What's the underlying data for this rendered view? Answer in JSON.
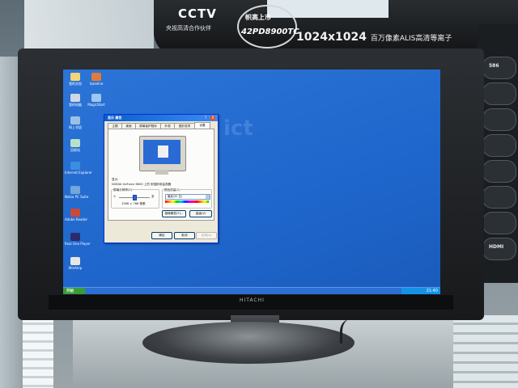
{
  "banner": {
    "logo": "CCTV",
    "logo_sub": "央视高清合作伙伴",
    "badge_cn": "帜高上市",
    "badge_model": "42PD8900TC",
    "resolution": "1024x1024",
    "resolution_sub": "百万像素ALIS高清等离子"
  },
  "promo": {
    "items": [
      "586",
      "",
      "",
      "",
      "",
      "",
      "",
      "HDMI"
    ]
  },
  "monitor": {
    "brand": "HITACHI"
  },
  "desktop": {
    "icons": [
      {
        "label": "我的文档"
      },
      {
        "label": "Isoinline"
      },
      {
        "label": "我的电脑"
      },
      {
        "label": "MagicStart"
      },
      {
        "label": "网上邻居"
      },
      {
        "label": "回收站"
      },
      {
        "label": "Internet Explorer"
      },
      {
        "label": "Nokia PC Suite"
      },
      {
        "label": "Adobe Reader"
      },
      {
        "label": "Real One Player"
      },
      {
        "label": "WinAmp"
      }
    ],
    "watermark": "ict"
  },
  "dialog": {
    "title": "显示 属性",
    "help": "?",
    "close": "X",
    "tabs": [
      "主题",
      "桌面",
      "屏幕保护程序",
      "外观",
      "图形选项",
      "设置"
    ],
    "display_label": "显示:",
    "display_value": "NVIDIA GeForce 6600 上的 即插即用监视器",
    "resolution_label": "屏幕分辨率(S)",
    "slider_min": "少",
    "slider_max": "多",
    "resolution_value": "1366 × 768 像素",
    "color_label": "颜色质量(C)",
    "color_value": "最高(32 位)",
    "troubleshoot_button": "疑难解答(T)...",
    "advanced_button": "高级(V)",
    "ok_button": "确定",
    "cancel_button": "取消",
    "apply_button": "应用(A)"
  },
  "taskbar": {
    "start": "开始",
    "time": "21:40"
  }
}
